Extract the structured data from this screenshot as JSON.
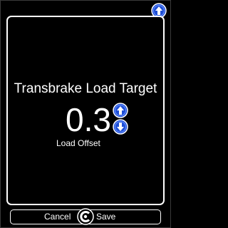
{
  "screen": {
    "title": "Transbrake Load Target",
    "value": "0.3",
    "sublabel": "Load Offset"
  },
  "footer": {
    "cancel_label": "Cancel",
    "save_label": "Save"
  },
  "icons": {
    "top_button": "arrow-up-icon",
    "increment": "arrow-up-icon",
    "decrement": "arrow-down-icon",
    "selector": "dial-icon"
  },
  "colors": {
    "background": "#000000",
    "foreground": "#ffffff",
    "button_fill": "#1f4fd6",
    "button_ring": "#ffffff"
  }
}
